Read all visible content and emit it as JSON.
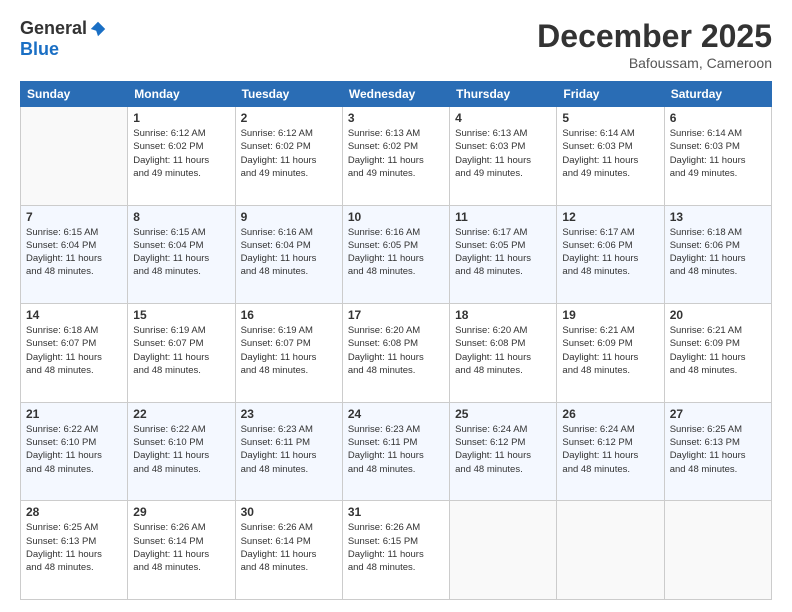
{
  "header": {
    "logo_general": "General",
    "logo_blue": "Blue",
    "month_title": "December 2025",
    "location": "Bafoussam, Cameroon"
  },
  "weekdays": [
    "Sunday",
    "Monday",
    "Tuesday",
    "Wednesday",
    "Thursday",
    "Friday",
    "Saturday"
  ],
  "weeks": [
    [
      {
        "day": "",
        "info": ""
      },
      {
        "day": "1",
        "info": "Sunrise: 6:12 AM\nSunset: 6:02 PM\nDaylight: 11 hours\nand 49 minutes."
      },
      {
        "day": "2",
        "info": "Sunrise: 6:12 AM\nSunset: 6:02 PM\nDaylight: 11 hours\nand 49 minutes."
      },
      {
        "day": "3",
        "info": "Sunrise: 6:13 AM\nSunset: 6:02 PM\nDaylight: 11 hours\nand 49 minutes."
      },
      {
        "day": "4",
        "info": "Sunrise: 6:13 AM\nSunset: 6:03 PM\nDaylight: 11 hours\nand 49 minutes."
      },
      {
        "day": "5",
        "info": "Sunrise: 6:14 AM\nSunset: 6:03 PM\nDaylight: 11 hours\nand 49 minutes."
      },
      {
        "day": "6",
        "info": "Sunrise: 6:14 AM\nSunset: 6:03 PM\nDaylight: 11 hours\nand 49 minutes."
      }
    ],
    [
      {
        "day": "7",
        "info": "Sunrise: 6:15 AM\nSunset: 6:04 PM\nDaylight: 11 hours\nand 48 minutes."
      },
      {
        "day": "8",
        "info": "Sunrise: 6:15 AM\nSunset: 6:04 PM\nDaylight: 11 hours\nand 48 minutes."
      },
      {
        "day": "9",
        "info": "Sunrise: 6:16 AM\nSunset: 6:04 PM\nDaylight: 11 hours\nand 48 minutes."
      },
      {
        "day": "10",
        "info": "Sunrise: 6:16 AM\nSunset: 6:05 PM\nDaylight: 11 hours\nand 48 minutes."
      },
      {
        "day": "11",
        "info": "Sunrise: 6:17 AM\nSunset: 6:05 PM\nDaylight: 11 hours\nand 48 minutes."
      },
      {
        "day": "12",
        "info": "Sunrise: 6:17 AM\nSunset: 6:06 PM\nDaylight: 11 hours\nand 48 minutes."
      },
      {
        "day": "13",
        "info": "Sunrise: 6:18 AM\nSunset: 6:06 PM\nDaylight: 11 hours\nand 48 minutes."
      }
    ],
    [
      {
        "day": "14",
        "info": "Sunrise: 6:18 AM\nSunset: 6:07 PM\nDaylight: 11 hours\nand 48 minutes."
      },
      {
        "day": "15",
        "info": "Sunrise: 6:19 AM\nSunset: 6:07 PM\nDaylight: 11 hours\nand 48 minutes."
      },
      {
        "day": "16",
        "info": "Sunrise: 6:19 AM\nSunset: 6:07 PM\nDaylight: 11 hours\nand 48 minutes."
      },
      {
        "day": "17",
        "info": "Sunrise: 6:20 AM\nSunset: 6:08 PM\nDaylight: 11 hours\nand 48 minutes."
      },
      {
        "day": "18",
        "info": "Sunrise: 6:20 AM\nSunset: 6:08 PM\nDaylight: 11 hours\nand 48 minutes."
      },
      {
        "day": "19",
        "info": "Sunrise: 6:21 AM\nSunset: 6:09 PM\nDaylight: 11 hours\nand 48 minutes."
      },
      {
        "day": "20",
        "info": "Sunrise: 6:21 AM\nSunset: 6:09 PM\nDaylight: 11 hours\nand 48 minutes."
      }
    ],
    [
      {
        "day": "21",
        "info": "Sunrise: 6:22 AM\nSunset: 6:10 PM\nDaylight: 11 hours\nand 48 minutes."
      },
      {
        "day": "22",
        "info": "Sunrise: 6:22 AM\nSunset: 6:10 PM\nDaylight: 11 hours\nand 48 minutes."
      },
      {
        "day": "23",
        "info": "Sunrise: 6:23 AM\nSunset: 6:11 PM\nDaylight: 11 hours\nand 48 minutes."
      },
      {
        "day": "24",
        "info": "Sunrise: 6:23 AM\nSunset: 6:11 PM\nDaylight: 11 hours\nand 48 minutes."
      },
      {
        "day": "25",
        "info": "Sunrise: 6:24 AM\nSunset: 6:12 PM\nDaylight: 11 hours\nand 48 minutes."
      },
      {
        "day": "26",
        "info": "Sunrise: 6:24 AM\nSunset: 6:12 PM\nDaylight: 11 hours\nand 48 minutes."
      },
      {
        "day": "27",
        "info": "Sunrise: 6:25 AM\nSunset: 6:13 PM\nDaylight: 11 hours\nand 48 minutes."
      }
    ],
    [
      {
        "day": "28",
        "info": "Sunrise: 6:25 AM\nSunset: 6:13 PM\nDaylight: 11 hours\nand 48 minutes."
      },
      {
        "day": "29",
        "info": "Sunrise: 6:26 AM\nSunset: 6:14 PM\nDaylight: 11 hours\nand 48 minutes."
      },
      {
        "day": "30",
        "info": "Sunrise: 6:26 AM\nSunset: 6:14 PM\nDaylight: 11 hours\nand 48 minutes."
      },
      {
        "day": "31",
        "info": "Sunrise: 6:26 AM\nSunset: 6:15 PM\nDaylight: 11 hours\nand 48 minutes."
      },
      {
        "day": "",
        "info": ""
      },
      {
        "day": "",
        "info": ""
      },
      {
        "day": "",
        "info": ""
      }
    ]
  ]
}
